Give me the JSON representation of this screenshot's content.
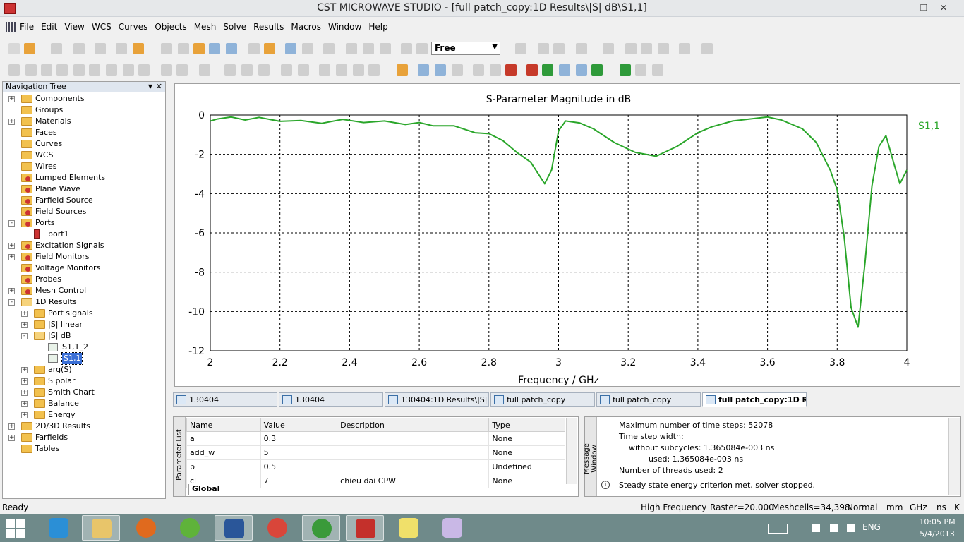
{
  "window": {
    "title": "CST MICROWAVE STUDIO - [full patch_copy:1D Results\\|S| dB\\S1,1]"
  },
  "menu": [
    "File",
    "Edit",
    "View",
    "WCS",
    "Curves",
    "Objects",
    "Mesh",
    "Solve",
    "Results",
    "Macros",
    "Window",
    "Help"
  ],
  "toolbar": {
    "mode_select": "Free"
  },
  "nav_tree": {
    "title": "Navigation Tree",
    "items": [
      {
        "label": "Components",
        "level": 0,
        "expand": "+",
        "icon": "folder"
      },
      {
        "label": "Groups",
        "level": 0,
        "expand": "",
        "icon": "folder"
      },
      {
        "label": "Materials",
        "level": 0,
        "expand": "+",
        "icon": "folder"
      },
      {
        "label": "Faces",
        "level": 0,
        "expand": "",
        "icon": "folder"
      },
      {
        "label": "Curves",
        "level": 0,
        "expand": "",
        "icon": "folder"
      },
      {
        "label": "WCS",
        "level": 0,
        "expand": "",
        "icon": "folder"
      },
      {
        "label": "Wires",
        "level": 0,
        "expand": "",
        "icon": "folder"
      },
      {
        "label": "Lumped Elements",
        "level": 0,
        "expand": "",
        "icon": "folder-red"
      },
      {
        "label": "Plane Wave",
        "level": 0,
        "expand": "",
        "icon": "folder-red"
      },
      {
        "label": "Farfield Source",
        "level": 0,
        "expand": "",
        "icon": "folder-red"
      },
      {
        "label": "Field Sources",
        "level": 0,
        "expand": "",
        "icon": "folder-red"
      },
      {
        "label": "Ports",
        "level": 0,
        "expand": "-",
        "icon": "folder-red"
      },
      {
        "label": "port1",
        "level": 1,
        "expand": "",
        "icon": "port"
      },
      {
        "label": "Excitation Signals",
        "level": 0,
        "expand": "+",
        "icon": "folder-red"
      },
      {
        "label": "Field Monitors",
        "level": 0,
        "expand": "+",
        "icon": "folder-red"
      },
      {
        "label": "Voltage Monitors",
        "level": 0,
        "expand": "",
        "icon": "folder-red"
      },
      {
        "label": "Probes",
        "level": 0,
        "expand": "",
        "icon": "folder-red"
      },
      {
        "label": "Mesh Control",
        "level": 0,
        "expand": "+",
        "icon": "folder-red"
      },
      {
        "label": "1D Results",
        "level": 0,
        "expand": "-",
        "icon": "folder-open"
      },
      {
        "label": "Port signals",
        "level": 1,
        "expand": "+",
        "icon": "folder"
      },
      {
        "label": "|S| linear",
        "level": 1,
        "expand": "+",
        "icon": "folder"
      },
      {
        "label": "|S| dB",
        "level": 1,
        "expand": "-",
        "icon": "folder-open"
      },
      {
        "label": "S1,1_2",
        "level": 2,
        "expand": "",
        "icon": "curve"
      },
      {
        "label": "S1,1",
        "level": 2,
        "expand": "",
        "icon": "curve",
        "selected": true
      },
      {
        "label": "arg(S)",
        "level": 1,
        "expand": "+",
        "icon": "folder"
      },
      {
        "label": "S polar",
        "level": 1,
        "expand": "+",
        "icon": "folder"
      },
      {
        "label": "Smith Chart",
        "level": 1,
        "expand": "+",
        "icon": "folder"
      },
      {
        "label": "Balance",
        "level": 1,
        "expand": "+",
        "icon": "folder"
      },
      {
        "label": "Energy",
        "level": 1,
        "expand": "+",
        "icon": "folder"
      },
      {
        "label": "2D/3D Results",
        "level": 0,
        "expand": "+",
        "icon": "folder"
      },
      {
        "label": "Farfields",
        "level": 0,
        "expand": "+",
        "icon": "folder"
      },
      {
        "label": "Tables",
        "level": 0,
        "expand": "",
        "icon": "folder"
      }
    ]
  },
  "chart_data": {
    "type": "line",
    "title": "S-Parameter Magnitude in dB",
    "xlabel": "Frequency / GHz",
    "ylabel": "",
    "xlim": [
      2,
      4
    ],
    "ylim": [
      -12,
      0
    ],
    "xticks": [
      "2",
      "2.2",
      "2.4",
      "2.6",
      "2.8",
      "3",
      "3.2",
      "3.4",
      "3.6",
      "3.8",
      "4"
    ],
    "yticks": [
      "0",
      "-2",
      "-4",
      "-6",
      "-8",
      "-10",
      "-12"
    ],
    "grid": true,
    "legend_position": "top-right",
    "series": [
      {
        "name": "S1,1",
        "color": "#2aa62a",
        "x": [
          2,
          2.02,
          2.06,
          2.1,
          2.14,
          2.2,
          2.26,
          2.32,
          2.38,
          2.44,
          2.5,
          2.56,
          2.6,
          2.64,
          2.7,
          2.76,
          2.8,
          2.84,
          2.88,
          2.92,
          2.96,
          2.98,
          3.0,
          3.02,
          3.06,
          3.1,
          3.16,
          3.22,
          3.28,
          3.34,
          3.4,
          3.44,
          3.5,
          3.56,
          3.6,
          3.64,
          3.7,
          3.74,
          3.78,
          3.8,
          3.82,
          3.84,
          3.86,
          3.88,
          3.9,
          3.92,
          3.94,
          3.96,
          3.98,
          4.0
        ],
        "y": [
          -0.3,
          -0.2,
          -0.1,
          -0.25,
          -0.12,
          -0.32,
          -0.28,
          -0.42,
          -0.22,
          -0.38,
          -0.3,
          -0.48,
          -0.38,
          -0.55,
          -0.55,
          -0.9,
          -0.95,
          -1.3,
          -1.9,
          -2.4,
          -3.5,
          -2.8,
          -0.8,
          -0.3,
          -0.4,
          -0.7,
          -1.4,
          -1.9,
          -2.1,
          -1.6,
          -0.9,
          -0.6,
          -0.3,
          -0.18,
          -0.1,
          -0.25,
          -0.7,
          -1.4,
          -2.8,
          -3.8,
          -6.2,
          -9.8,
          -10.8,
          -7.5,
          -3.6,
          -1.6,
          -1.05,
          -2.3,
          -3.5,
          -2.8
        ]
      }
    ]
  },
  "window_tabs": [
    {
      "label": "130404",
      "active": false
    },
    {
      "label": "130404",
      "active": false
    },
    {
      "label": "130404:1D Results\\|S| ...",
      "active": false
    },
    {
      "label": "full patch_copy",
      "active": false
    },
    {
      "label": "full patch_copy",
      "active": false
    },
    {
      "label": "full patch_copy:1D R...",
      "active": true
    }
  ],
  "parameter_list": {
    "side_label": "Parameter List",
    "columns": [
      "Name",
      "Value",
      "Description",
      "Type"
    ],
    "rows": [
      [
        "a",
        "0.3",
        "",
        "None"
      ],
      [
        "add_w",
        "5",
        "",
        "None"
      ],
      [
        "b",
        "0.5",
        "",
        "Undefined"
      ],
      [
        "cl",
        "7",
        "chieu dai CPW",
        "None"
      ]
    ],
    "tab": "Global"
  },
  "message_window": {
    "side_label": "Message Window",
    "lines": [
      "Maximum number of time steps: 52078",
      "Time step width:",
      "without subcycles: 1.365084e-003 ns",
      "used: 1.365084e-003 ns",
      "Number of threads used: 2",
      "Steady state energy criterion met, solver stopped."
    ]
  },
  "status": {
    "left": "Ready",
    "solver": "High Frequency",
    "raster": "Raster=20.000",
    "meshcells": "Meshcells=34,398",
    "mode": "Normal",
    "units": "mm",
    "freq_unit": "GHz",
    "time_unit": "ns",
    "temp_unit": "K"
  },
  "taskbar": {
    "lang": "ENG",
    "time": "10:05 PM",
    "date": "5/4/2013",
    "apps": [
      "Internet Explorer",
      "File Explorer",
      "Firefox",
      "Chat",
      "Word",
      "Chrome",
      "uTorrent",
      "CST",
      "Sticky",
      "Paint"
    ]
  },
  "colors": {
    "accent": "#2aa62a",
    "selection": "#3a6fd6",
    "taskbar": "#6f8a8a"
  }
}
